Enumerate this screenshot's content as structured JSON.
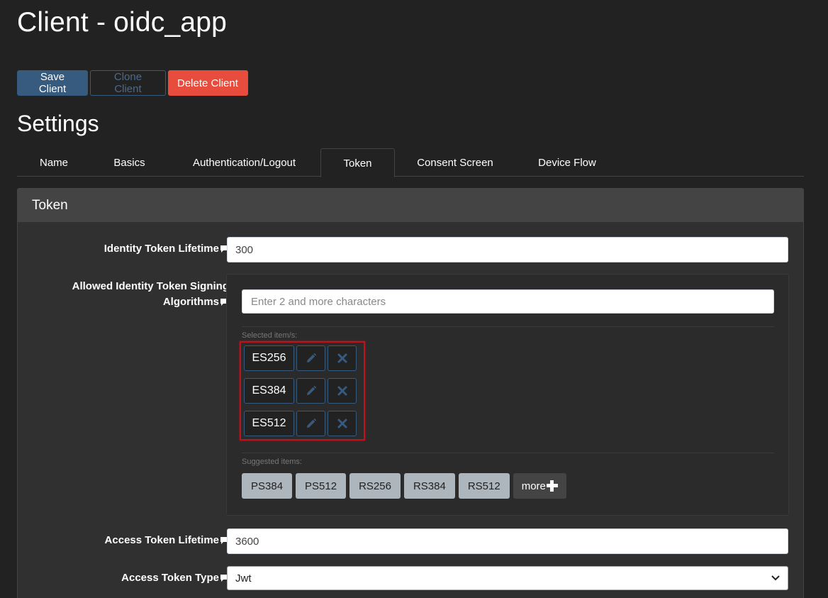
{
  "page": {
    "title": "Client - oidc_app"
  },
  "toolbar": {
    "save_label": "Save Client",
    "clone_label": "Clone Client",
    "delete_label": "Delete Client"
  },
  "settings": {
    "heading": "Settings"
  },
  "tabs": [
    {
      "label": "Name",
      "active": false
    },
    {
      "label": "Basics",
      "active": false
    },
    {
      "label": "Authentication/Logout",
      "active": false
    },
    {
      "label": "Token",
      "active": true
    },
    {
      "label": "Consent Screen",
      "active": false
    },
    {
      "label": "Device Flow",
      "active": false
    }
  ],
  "card": {
    "title": "Token"
  },
  "fields": {
    "identity_token_lifetime": {
      "label": "Identity Token Lifetime",
      "value": "300"
    },
    "allowed_signing_algorithms": {
      "label_line1": "Allowed Identity Token Signing",
      "label_line2": "Algorithms",
      "placeholder": "Enter 2 and more characters",
      "selected_caption": "Selected item/s:",
      "selected": [
        "ES256",
        "ES384",
        "ES512"
      ],
      "suggested_caption": "Suggested items:",
      "suggested": [
        "PS384",
        "PS512",
        "RS256",
        "RS384",
        "RS512"
      ],
      "more_label": "more"
    },
    "access_token_lifetime": {
      "label": "Access Token Lifetime",
      "value": "3600"
    },
    "access_token_type": {
      "label": "Access Token Type",
      "value": "Jwt"
    }
  },
  "icons": {
    "help": "comment-icon",
    "edit": "pencil-icon",
    "remove": "close-icon",
    "add": "plus-icon",
    "select": "chevron-down-icon"
  },
  "colors": {
    "background": "#222222",
    "primary": "#375a7f",
    "danger": "#e74c3c",
    "highlight": "#c0121c"
  }
}
